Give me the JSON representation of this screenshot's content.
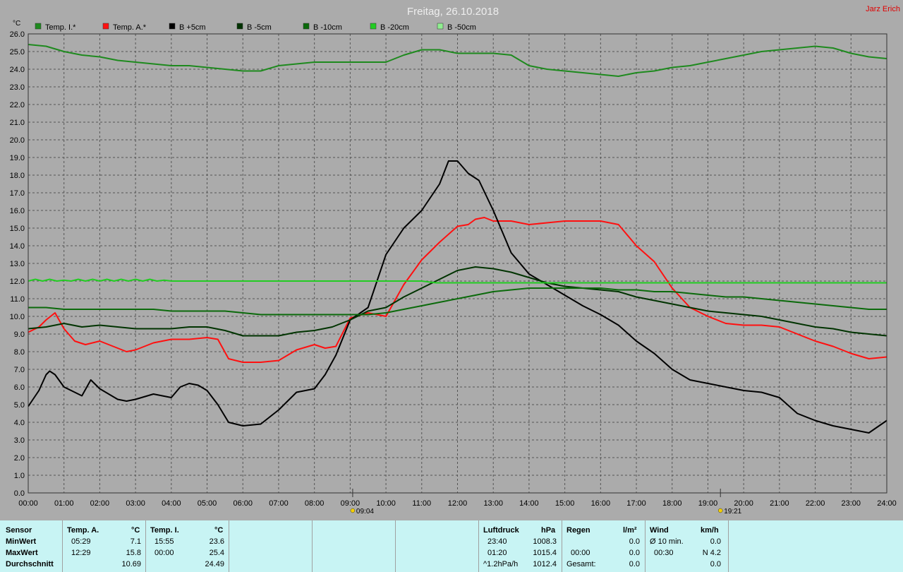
{
  "header": {
    "title": "Freitag, 26.10.2018",
    "author": "Jarz Erich"
  },
  "chart_data": {
    "type": "line",
    "title": "Freitag, 26.10.2018",
    "ylabel": "°C",
    "ylim": [
      0,
      26
    ],
    "yticks": [
      "0.0",
      "1.0",
      "2.0",
      "3.0",
      "4.0",
      "5.0",
      "6.0",
      "7.0",
      "8.0",
      "9.0",
      "10.0",
      "11.0",
      "12.0",
      "13.0",
      "14.0",
      "15.0",
      "16.0",
      "17.0",
      "18.0",
      "19.0",
      "20.0",
      "21.0",
      "22.0",
      "23.0",
      "24.0",
      "25.0",
      "26.0"
    ],
    "xlim": [
      0,
      24
    ],
    "xticks": [
      "00:00",
      "01:00",
      "02:00",
      "03:00",
      "04:00",
      "05:00",
      "06:00",
      "07:00",
      "08:00",
      "09:00",
      "10:00",
      "11:00",
      "12:00",
      "13:00",
      "14:00",
      "15:00",
      "16:00",
      "17:00",
      "18:00",
      "19:00",
      "20:00",
      "21:00",
      "22:00",
      "23:00",
      "24:00"
    ],
    "grid": true,
    "legend_position": "top-left",
    "markers": [
      {
        "label": "09:04",
        "x": 9.07,
        "icon": "sunrise-icon"
      },
      {
        "label": "19:21",
        "x": 19.35,
        "icon": "sunset-icon"
      }
    ],
    "series": [
      {
        "name": "Temp. I.*",
        "color": "#1e8a1e",
        "x": [
          0,
          0.5,
          1,
          1.5,
          2,
          2.5,
          3,
          3.5,
          4,
          4.5,
          5,
          5.5,
          6,
          6.5,
          7,
          7.5,
          8,
          8.5,
          9,
          9.5,
          10,
          10.5,
          11,
          11.5,
          12,
          12.5,
          13,
          13.5,
          14,
          14.5,
          15,
          15.5,
          16,
          16.5,
          17,
          17.5,
          18,
          18.5,
          19,
          19.5,
          20,
          20.5,
          21,
          21.5,
          22,
          22.5,
          23,
          23.5,
          24
        ],
        "values": [
          25.4,
          25.3,
          25,
          24.8,
          24.7,
          24.5,
          24.4,
          24.3,
          24.2,
          24.2,
          24.1,
          24,
          23.9,
          23.9,
          24.2,
          24.3,
          24.4,
          24.4,
          24.4,
          24.4,
          24.4,
          24.8,
          25.1,
          25.1,
          24.9,
          24.9,
          24.9,
          24.8,
          24.2,
          24,
          23.9,
          23.8,
          23.7,
          23.6,
          23.8,
          23.9,
          24.1,
          24.2,
          24.4,
          24.6,
          24.8,
          25,
          25.1,
          25.2,
          25.3,
          25.2,
          24.9,
          24.7,
          24.6
        ]
      },
      {
        "name": "Temp. A.*",
        "color": "#ff1010",
        "x": [
          0,
          0.3,
          0.5,
          0.75,
          1,
          1.3,
          1.6,
          2,
          2.5,
          2.75,
          3,
          3.5,
          4,
          4.5,
          5,
          5.3,
          5.6,
          6,
          6.5,
          7,
          7.5,
          8,
          8.3,
          8.6,
          9,
          9.5,
          10,
          10.5,
          11,
          11.5,
          12,
          12.3,
          12.5,
          12.75,
          13,
          13.5,
          14,
          14.5,
          15,
          15.5,
          16,
          16.5,
          17,
          17.5,
          18,
          18.5,
          19,
          19.5,
          20,
          20.5,
          21,
          21.5,
          22,
          22.5,
          23,
          23.5,
          24
        ],
        "values": [
          9.1,
          9.4,
          9.8,
          10.2,
          9.3,
          8.6,
          8.4,
          8.6,
          8.2,
          8,
          8.1,
          8.5,
          8.7,
          8.7,
          8.8,
          8.7,
          7.6,
          7.4,
          7.4,
          7.5,
          8.1,
          8.4,
          8.2,
          8.3,
          9.9,
          10.2,
          10,
          11.8,
          13.2,
          14.2,
          15.1,
          15.2,
          15.5,
          15.6,
          15.4,
          15.4,
          15.2,
          15.3,
          15.4,
          15.4,
          15.4,
          15.2,
          14,
          13.1,
          11.6,
          10.5,
          10,
          9.6,
          9.5,
          9.5,
          9.4,
          9,
          8.6,
          8.3,
          7.9,
          7.6,
          7.7
        ]
      },
      {
        "name": "B +5cm",
        "color": "#000000",
        "x": [
          0,
          0.3,
          0.5,
          0.6,
          0.75,
          1,
          1.5,
          1.75,
          2,
          2.5,
          2.75,
          3,
          3.5,
          4,
          4.25,
          4.5,
          4.75,
          5,
          5.3,
          5.6,
          6,
          6.5,
          7,
          7.5,
          8,
          8.3,
          8.6,
          9,
          9.5,
          10,
          10.5,
          11,
          11.5,
          11.75,
          12,
          12.3,
          12.6,
          13,
          13.5,
          14,
          14.5,
          15,
          15.5,
          16,
          16.5,
          17,
          17.5,
          18,
          18.5,
          19,
          19.5,
          20,
          20.5,
          21,
          21.5,
          22,
          22.5,
          23,
          23.5,
          24
        ],
        "values": [
          4.9,
          5.8,
          6.7,
          6.9,
          6.7,
          6,
          5.5,
          6.4,
          5.9,
          5.3,
          5.2,
          5.3,
          5.6,
          5.4,
          6,
          6.2,
          6.1,
          5.8,
          5,
          4,
          3.8,
          3.9,
          4.7,
          5.7,
          5.9,
          6.7,
          7.8,
          9.8,
          10.5,
          13.5,
          15,
          16,
          17.5,
          18.8,
          18.8,
          18.1,
          17.7,
          16,
          13.6,
          12.4,
          11.8,
          11.2,
          10.6,
          10.1,
          9.5,
          8.6,
          7.9,
          7,
          6.4,
          6.2,
          6,
          5.8,
          5.7,
          5.4,
          4.5,
          4.1,
          3.8,
          3.6,
          3.4,
          4.1
        ]
      },
      {
        "name": "B -5cm",
        "color": "#003300",
        "x": [
          0,
          0.5,
          1,
          1.5,
          2,
          2.5,
          3,
          3.5,
          4,
          4.5,
          5,
          5.5,
          6,
          6.5,
          7,
          7.5,
          8,
          8.5,
          9,
          9.5,
          10,
          10.5,
          11,
          11.5,
          12,
          12.5,
          13,
          13.5,
          14,
          14.5,
          15,
          15.5,
          16,
          16.5,
          17,
          17.5,
          18,
          18.5,
          19,
          19.5,
          20,
          20.5,
          21,
          21.5,
          22,
          22.5,
          23,
          23.5,
          24
        ],
        "values": [
          9.3,
          9.4,
          9.6,
          9.4,
          9.5,
          9.4,
          9.3,
          9.3,
          9.3,
          9.4,
          9.4,
          9.2,
          8.9,
          8.9,
          8.9,
          9.1,
          9.2,
          9.4,
          9.8,
          10.3,
          10.5,
          11.1,
          11.6,
          12.1,
          12.6,
          12.8,
          12.7,
          12.5,
          12.2,
          11.9,
          11.7,
          11.6,
          11.5,
          11.4,
          11.1,
          10.9,
          10.7,
          10.5,
          10.3,
          10.2,
          10.1,
          10,
          9.8,
          9.6,
          9.4,
          9.3,
          9.1,
          9,
          8.9
        ]
      },
      {
        "name": "B -10cm",
        "color": "#0b6a0b",
        "x": [
          0,
          0.5,
          1,
          1.5,
          2,
          2.5,
          3,
          3.5,
          4,
          4.5,
          5,
          5.5,
          6,
          6.5,
          7,
          7.5,
          8,
          8.5,
          9,
          9.5,
          10,
          10.5,
          11,
          11.5,
          12,
          12.5,
          13,
          13.5,
          14,
          14.5,
          15,
          15.5,
          16,
          16.5,
          17,
          17.5,
          18,
          18.5,
          19,
          19.5,
          20,
          20.5,
          21,
          21.5,
          22,
          22.5,
          23,
          23.5,
          24
        ],
        "values": [
          10.5,
          10.5,
          10.4,
          10.4,
          10.4,
          10.4,
          10.4,
          10.4,
          10.3,
          10.3,
          10.3,
          10.3,
          10.2,
          10.1,
          10.1,
          10.1,
          10.1,
          10.1,
          10.1,
          10.1,
          10.2,
          10.4,
          10.6,
          10.8,
          11,
          11.2,
          11.4,
          11.5,
          11.6,
          11.6,
          11.6,
          11.6,
          11.6,
          11.5,
          11.5,
          11.4,
          11.4,
          11.3,
          11.2,
          11.1,
          11.1,
          11,
          10.9,
          10.8,
          10.7,
          10.6,
          10.5,
          10.4,
          10.4
        ]
      },
      {
        "name": "B -20cm",
        "color": "#22cc22",
        "x": [
          0,
          0.2,
          0.4,
          0.6,
          0.8,
          1,
          1.2,
          1.4,
          1.6,
          1.8,
          2,
          2.2,
          2.4,
          2.6,
          2.8,
          3,
          3.2,
          3.4,
          3.6,
          3.8,
          4,
          5,
          6,
          7,
          8,
          9,
          10,
          11,
          11.2,
          11.4,
          12,
          13,
          14,
          15,
          16,
          17,
          18,
          19,
          20,
          21,
          22,
          23,
          24
        ],
        "values": [
          12,
          12.1,
          12,
          12.1,
          12,
          12.05,
          12,
          12.1,
          12,
          12.1,
          12,
          12.1,
          12,
          12.1,
          12,
          12.1,
          12,
          12.1,
          12,
          12.05,
          12,
          12,
          12,
          12,
          12,
          12,
          12,
          12,
          11.95,
          11.9,
          11.9,
          11.9,
          11.9,
          11.9,
          11.9,
          11.9,
          11.9,
          11.9,
          11.9,
          11.9,
          11.9,
          11.9,
          11.9
        ]
      },
      {
        "name": "B -50cm",
        "color": "#90ee90",
        "x": [],
        "values": []
      }
    ]
  },
  "stats": {
    "sensor": {
      "header": "Sensor",
      "rows": [
        "MinWert",
        "MaxWert",
        "Durchschnitt"
      ]
    },
    "temp_a": {
      "header": "Temp. A.",
      "unit": "°C",
      "min_time": "05:29",
      "min_val": "7.1",
      "max_time": "12:29",
      "max_val": "15.8",
      "avg_val": "10.69"
    },
    "temp_i": {
      "header": "Temp. I.",
      "unit": "°C",
      "min_time": "15:55",
      "min_val": "23.6",
      "max_time": "00:00",
      "max_val": "25.4",
      "avg_val": "24.49"
    },
    "pressure": {
      "header": "Luftdruck",
      "unit": "hPa",
      "r1_label": "23:40",
      "r1_val": "1008.3",
      "r2_label": "01:20",
      "r2_val": "1015.4",
      "r3_label": "^1.2hPa/h",
      "r3_val": "1012.4"
    },
    "rain": {
      "header": "Regen",
      "unit": "l/m²",
      "r1_val": "0.0",
      "r2_label": "00:00",
      "r2_val": "0.0",
      "r3_label": "Gesamt:",
      "r3_val": "0.0"
    },
    "wind": {
      "header": "Wind",
      "unit": "km/h",
      "r1_label": "Ø 10 min.",
      "r1_val": "0.0",
      "r2_label": "00:30",
      "r2_val": "N 4.2",
      "r3_val": "0.0"
    }
  }
}
